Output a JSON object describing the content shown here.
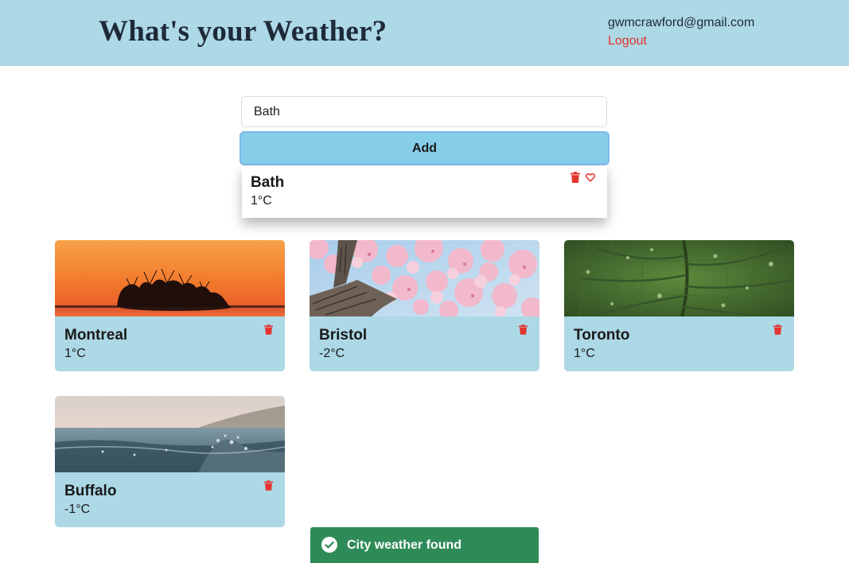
{
  "header": {
    "title": "What's your Weather?",
    "user_email": "gwmcrawford@gmail.com",
    "logout_label": "Logout",
    "background_color": "#add8e6"
  },
  "search": {
    "value": "Bath",
    "add_label": "Add",
    "button_color": "#87ceeb"
  },
  "search_result": {
    "city": "Bath",
    "temperature": "1°C",
    "icons": [
      "trash-icon",
      "heart-icon"
    ]
  },
  "cities": [
    {
      "name": "Montreal",
      "temperature": "1°C",
      "image": "sunset-island-photo"
    },
    {
      "name": "Bristol",
      "temperature": "-2°C",
      "image": "cherry-blossom-photo"
    },
    {
      "name": "Toronto",
      "temperature": "1°C",
      "image": "green-leaf-photo"
    },
    {
      "name": "Buffalo",
      "temperature": "-1°C",
      "image": "water-wave-photo"
    }
  ],
  "toast": {
    "message": "City weather found",
    "icon": "check-circle-icon",
    "color": "#2e8b57"
  },
  "colors": {
    "card_background": "#add8e6",
    "delete_red": "#e3342f"
  }
}
